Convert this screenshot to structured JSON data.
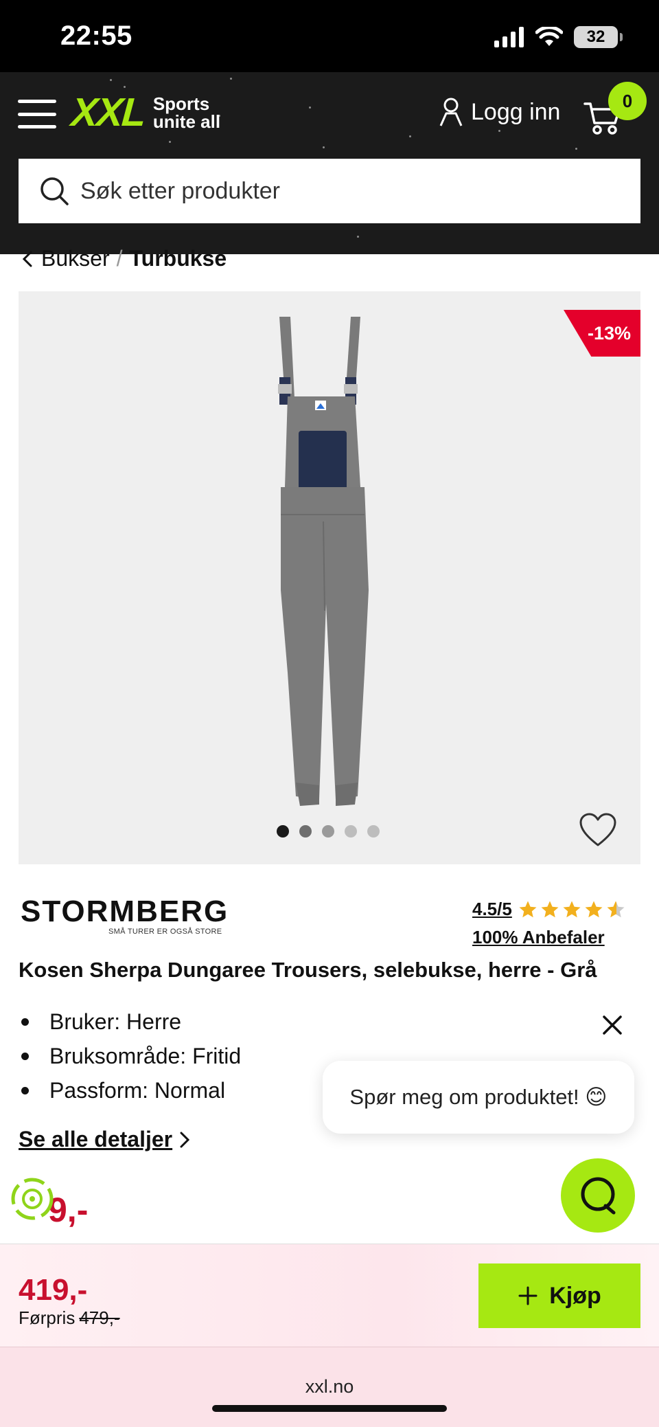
{
  "status_bar": {
    "time": "22:55",
    "battery": "32"
  },
  "header": {
    "logo_text": "XXL",
    "tagline_line1": "Sports",
    "tagline_line2": "unite all",
    "login_label": "Logg inn",
    "cart_count": "0",
    "search_placeholder": "Søk etter produkter",
    "accent_color": "#a6e812"
  },
  "breadcrumb": {
    "parent": "Bukser",
    "separator": "/",
    "current": "Turbukse"
  },
  "product": {
    "discount": "-13%",
    "image_count": 5,
    "active_image": 1,
    "brand_name": "STORMBERG",
    "brand_tagline": "SMÅ TURER ER OGSÅ STORE",
    "rating": "4.5/5",
    "rating_stars": 4.5,
    "recommend": "100% Anbefaler",
    "title": "Kosen Sherpa Dungaree Trousers, selebukse, herre - Grå",
    "features": [
      "Bruker: Herre",
      "Bruksområde: Fritid",
      "Passform: Normal"
    ],
    "details_link": "Se alle detaljer",
    "price_partial": "9,-"
  },
  "chat": {
    "prompt": "Spør meg om produktet! 😊"
  },
  "buy_bar": {
    "price": "419,-",
    "before_label": "Førpris",
    "before_price": "479,-",
    "button_label": "Kjøp",
    "price_color": "#c8102e"
  },
  "browser": {
    "url": "xxl.no"
  }
}
